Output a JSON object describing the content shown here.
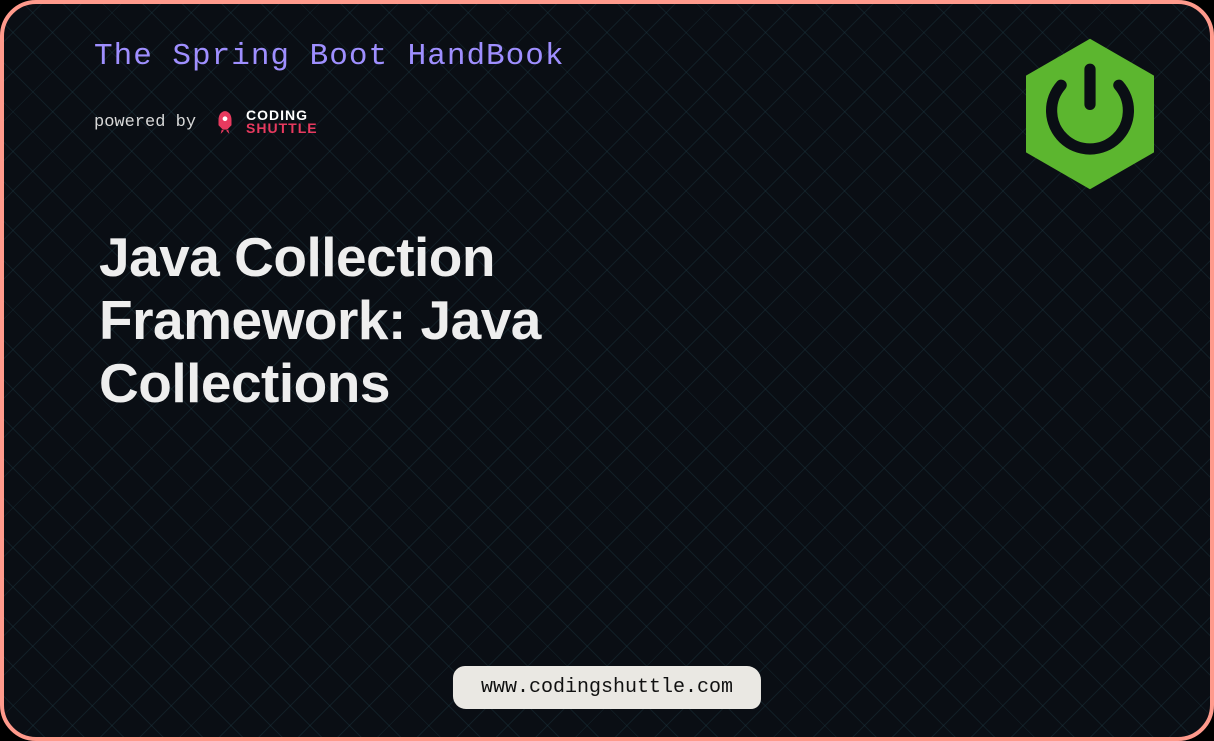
{
  "header": {
    "title": "The Spring Boot HandBook",
    "powered_by_label": "powered by",
    "brand_line1": "CODING",
    "brand_line2": "SHUTTLE"
  },
  "main": {
    "title": "Java Collection Framework: Java Collections"
  },
  "footer": {
    "url": "www.codingshuttle.com"
  },
  "colors": {
    "border": "#ff9a8c",
    "header_title": "#9f8fff",
    "spring_green": "#5cb62f",
    "brand_pink": "#e83a5f"
  }
}
